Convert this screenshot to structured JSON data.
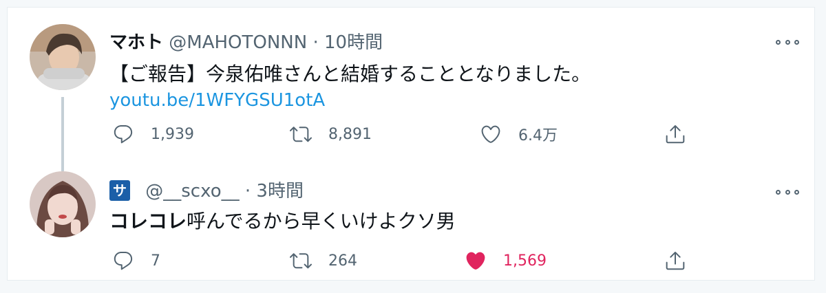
{
  "tweets": [
    {
      "name": "マホト",
      "handle": "@MAHOTONNN",
      "dot": "·",
      "time": "10時間",
      "text": "【ご報告】今泉佑唯さんと結婚することとなりました。",
      "link": "youtu.be/1WFYGSU1otA",
      "replies": "1,939",
      "retweets": "8,891",
      "likes": "6.4万"
    },
    {
      "badge": "サ",
      "handle": "@__scxo__",
      "dot": "·",
      "time": "3時間",
      "text_bold": "コレコレ",
      "text_rest": "呼んでるから早くいけよクソ男",
      "replies": "7",
      "retweets": "264",
      "likes": "1,569",
      "liked": true
    }
  ],
  "colors": {
    "link": "#1b95e0",
    "like_active": "#e0245e",
    "secondary": "#536471"
  }
}
